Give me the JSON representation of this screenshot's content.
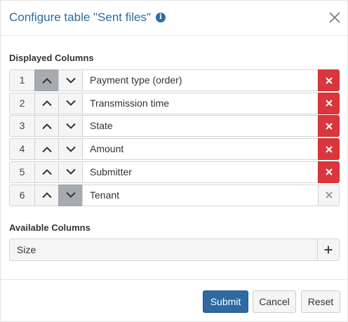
{
  "dialog": {
    "title": "Configure table \"Sent files\"",
    "info_icon": "info-circle-icon",
    "close_icon": "close-icon"
  },
  "displayed": {
    "heading": "Displayed Columns",
    "rows": [
      {
        "index": "1",
        "label": "Payment type (order)",
        "up_active": true,
        "down_active": false,
        "removable": true
      },
      {
        "index": "2",
        "label": "Transmission time",
        "up_active": false,
        "down_active": false,
        "removable": true
      },
      {
        "index": "3",
        "label": "State",
        "up_active": false,
        "down_active": false,
        "removable": true
      },
      {
        "index": "4",
        "label": "Amount",
        "up_active": false,
        "down_active": false,
        "removable": true
      },
      {
        "index": "5",
        "label": "Submitter",
        "up_active": false,
        "down_active": false,
        "removable": true
      },
      {
        "index": "6",
        "label": "Tenant",
        "up_active": false,
        "down_active": true,
        "removable": false
      }
    ]
  },
  "available": {
    "heading": "Available Columns",
    "items": [
      {
        "label": "Size"
      }
    ]
  },
  "footer": {
    "submit_label": "Submit",
    "cancel_label": "Cancel",
    "reset_label": "Reset"
  },
  "colors": {
    "title": "#2e6a9e",
    "delete": "#d9363e",
    "submit": "#2c6aa0",
    "active_arrow": "#a7abb0"
  }
}
